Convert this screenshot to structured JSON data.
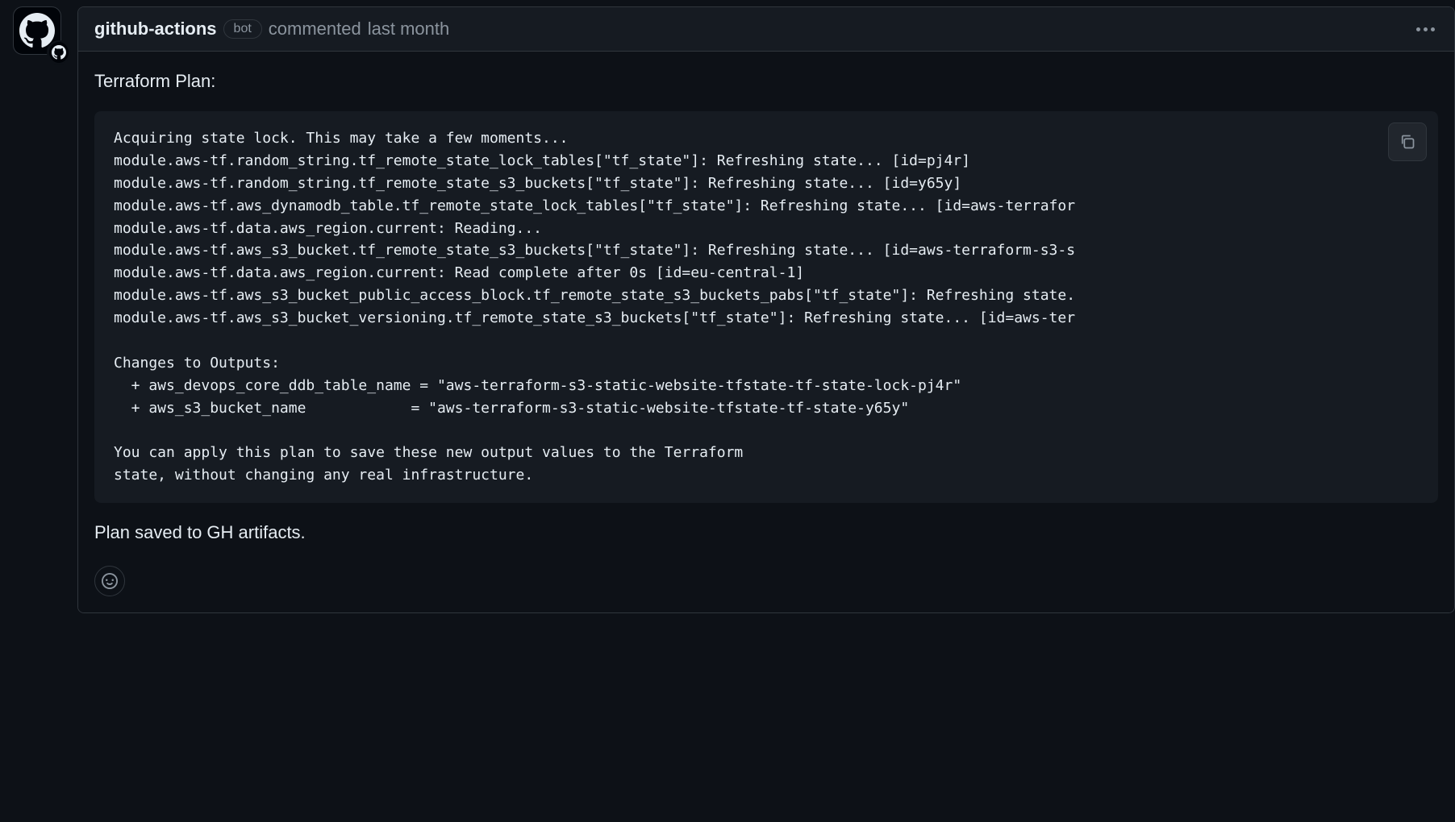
{
  "comment": {
    "author": "github-actions",
    "bot_label": "bot",
    "action_text": "commented",
    "timestamp": "last month",
    "body_heading": "Terraform Plan:",
    "code_lines": [
      "Acquiring state lock. This may take a few moments...",
      "module.aws-tf.random_string.tf_remote_state_lock_tables[\"tf_state\"]: Refreshing state... [id=pj4r]",
      "module.aws-tf.random_string.tf_remote_state_s3_buckets[\"tf_state\"]: Refreshing state... [id=y65y]",
      "module.aws-tf.aws_dynamodb_table.tf_remote_state_lock_tables[\"tf_state\"]: Refreshing state... [id=aws-terrafor",
      "module.aws-tf.data.aws_region.current: Reading...",
      "module.aws-tf.aws_s3_bucket.tf_remote_state_s3_buckets[\"tf_state\"]: Refreshing state... [id=aws-terraform-s3-s",
      "module.aws-tf.data.aws_region.current: Read complete after 0s [id=eu-central-1]",
      "module.aws-tf.aws_s3_bucket_public_access_block.tf_remote_state_s3_buckets_pabs[\"tf_state\"]: Refreshing state.",
      "module.aws-tf.aws_s3_bucket_versioning.tf_remote_state_s3_buckets[\"tf_state\"]: Refreshing state... [id=aws-ter",
      "",
      "Changes to Outputs:",
      "  + aws_devops_core_ddb_table_name = \"aws-terraform-s3-static-website-tfstate-tf-state-lock-pj4r\"",
      "  + aws_s3_bucket_name            = \"aws-terraform-s3-static-website-tfstate-tf-state-y65y\"",
      "",
      "You can apply this plan to save these new output values to the Terraform",
      "state, without changing any real infrastructure."
    ],
    "saved_text": "Plan saved to GH artifacts."
  }
}
